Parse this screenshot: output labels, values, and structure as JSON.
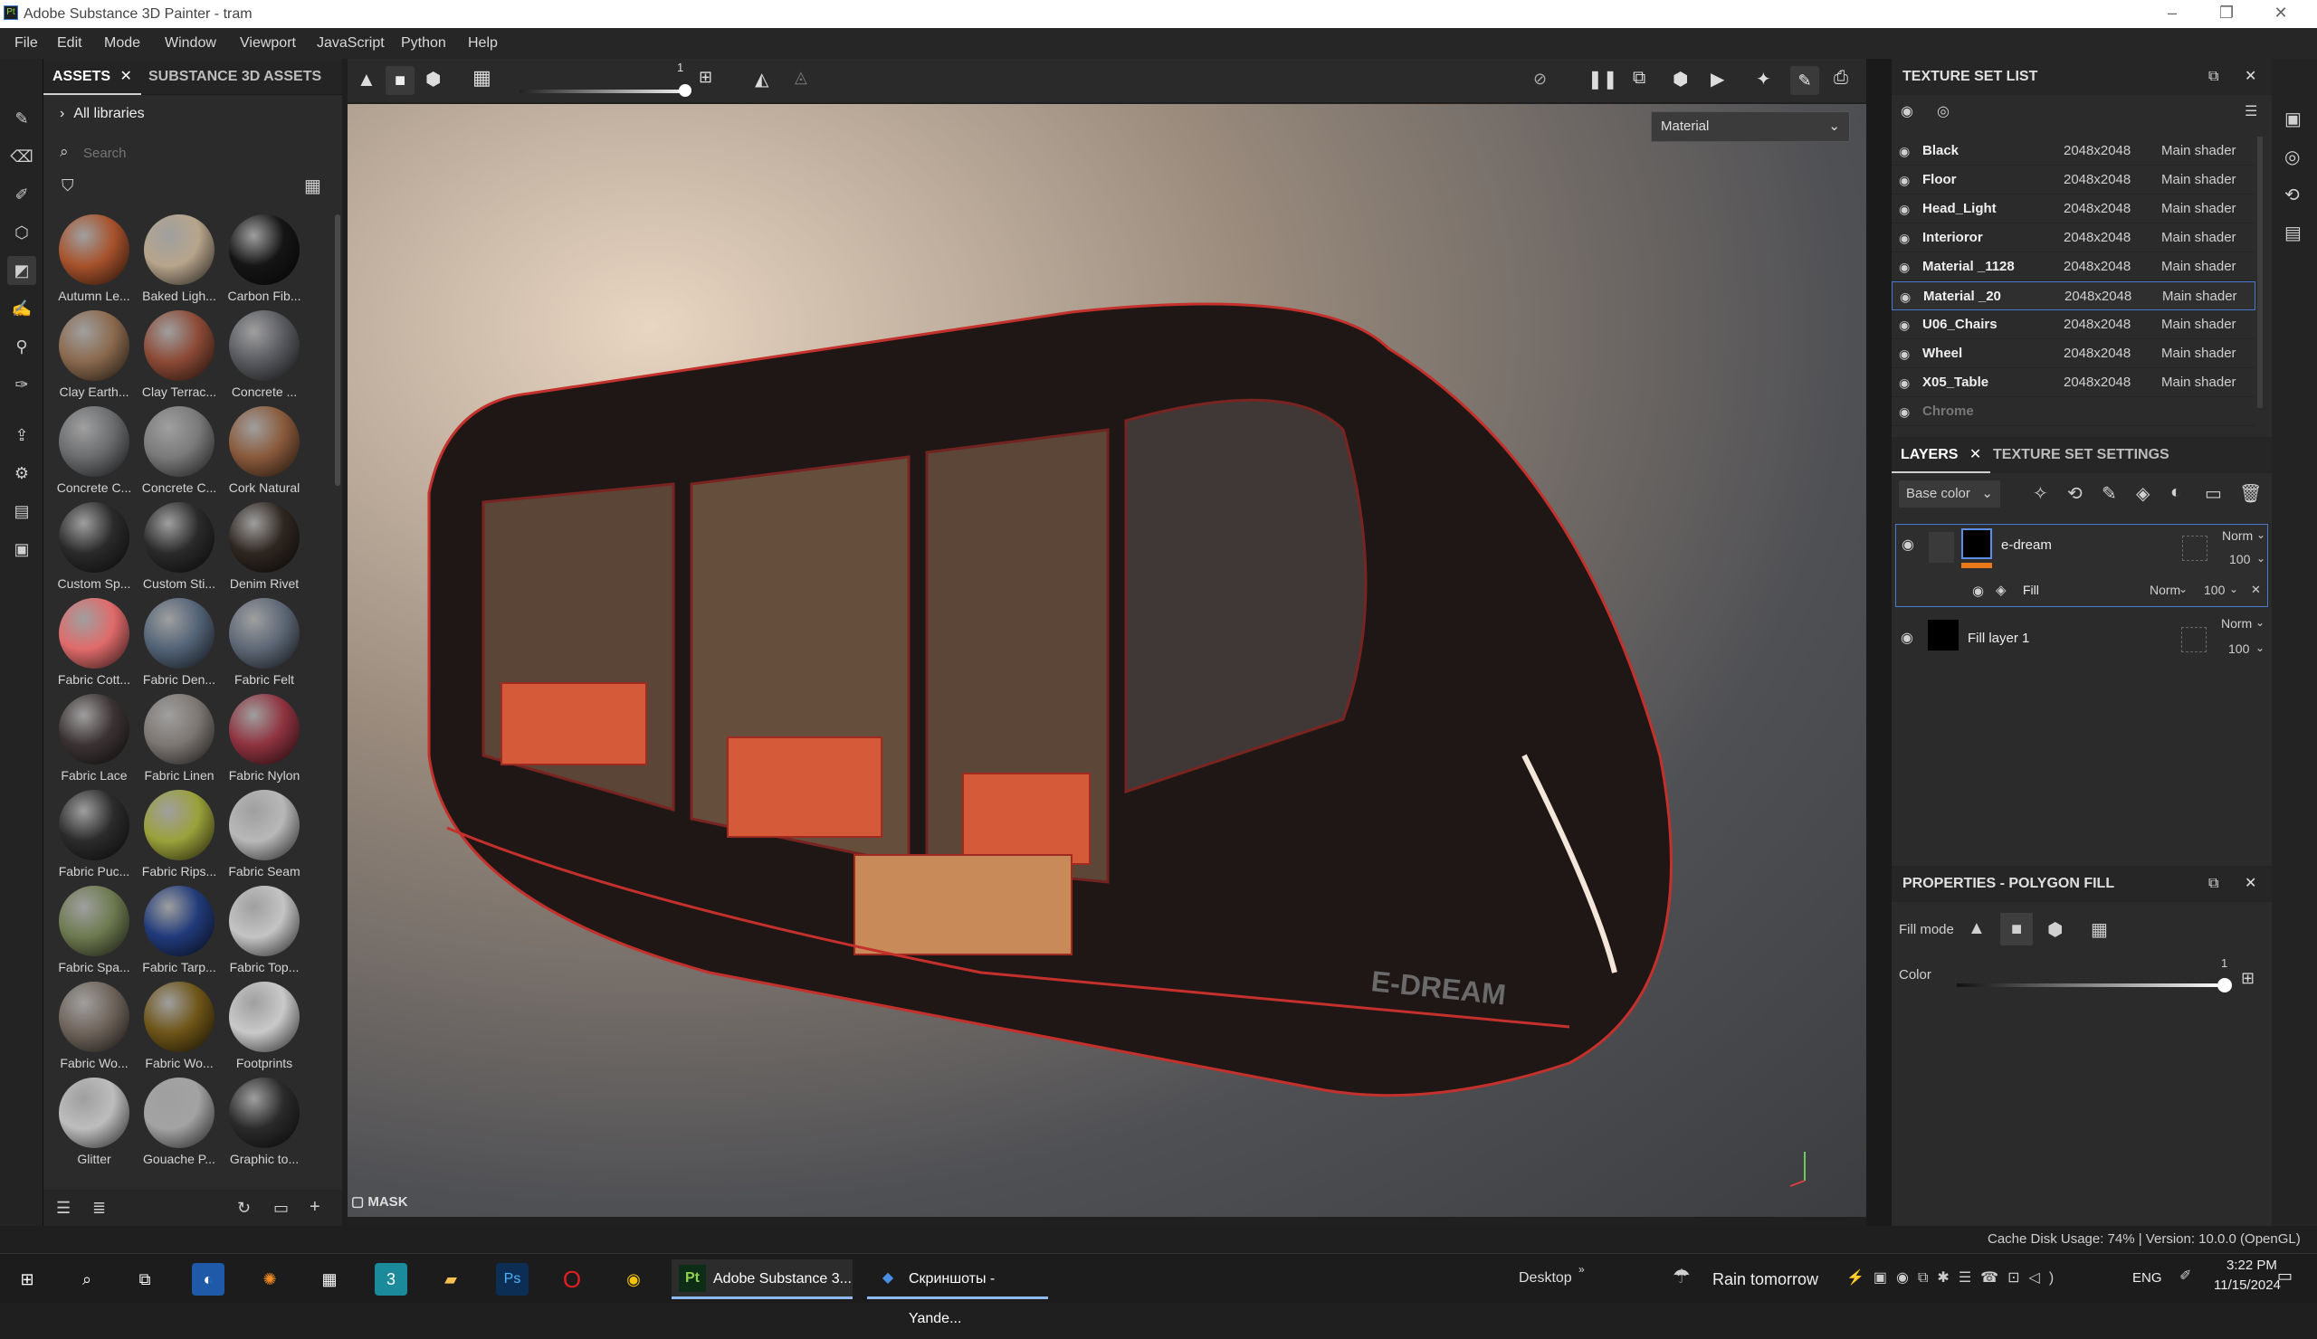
{
  "window": {
    "title": "Adobe Substance 3D Painter - tram",
    "app_icon": "Pt"
  },
  "menu": [
    "File",
    "Edit",
    "Mode",
    "Window",
    "Viewport",
    "JavaScript",
    "Python",
    "Help"
  ],
  "assets": {
    "tabs": [
      "ASSETS",
      "SUBSTANCE 3D ASSETS"
    ],
    "library": "All libraries",
    "search_placeholder": "Search",
    "items": [
      {
        "label": "Autumn Le...",
        "color": "#a7522c"
      },
      {
        "label": "Baked Ligh...",
        "color": "#b7a58c"
      },
      {
        "label": "Carbon Fib...",
        "color": "#151515"
      },
      {
        "label": "Clay Earth...",
        "color": "#8b6a4e"
      },
      {
        "label": "Clay Terrac...",
        "color": "#8c4a36"
      },
      {
        "label": "Concrete ...",
        "color": "#5a5b60"
      },
      {
        "label": "Concrete C...",
        "color": "#6b6c6e"
      },
      {
        "label": "Concrete C...",
        "color": "#7a7a7a"
      },
      {
        "label": "Cork Natural",
        "color": "#8a5a3c"
      },
      {
        "label": "Custom Sp...",
        "color": "#2a2a2a"
      },
      {
        "label": "Custom Sti...",
        "color": "#2a2a2a"
      },
      {
        "label": "Denim Rivet",
        "color": "#2e2620"
      },
      {
        "label": "Fabric Cott...",
        "color": "#e06b6b"
      },
      {
        "label": "Fabric Den...",
        "color": "#536377"
      },
      {
        "label": "Fabric Felt",
        "color": "#5e6876"
      },
      {
        "label": "Fabric Lace",
        "color": "#3b3333"
      },
      {
        "label": "Fabric Linen",
        "color": "#7d7773"
      },
      {
        "label": "Fabric Nylon",
        "color": "#8f3340"
      },
      {
        "label": "Fabric Puc...",
        "color": "#2b2b2b"
      },
      {
        "label": "Fabric Rips...",
        "color": "#9aa13a"
      },
      {
        "label": "Fabric Seam",
        "color": "#b8b8b8"
      },
      {
        "label": "Fabric Spa...",
        "color": "#6e7a50"
      },
      {
        "label": "Fabric Tarp...",
        "color": "#213a7a"
      },
      {
        "label": "Fabric Top...",
        "color": "#c4c4c4"
      },
      {
        "label": "Fabric Wo...",
        "color": "#6f645b"
      },
      {
        "label": "Fabric Wo...",
        "color": "#6e5518"
      },
      {
        "label": "Footprints",
        "color": "#c9c9c9"
      },
      {
        "label": "Glitter",
        "color": "#bdbdbd"
      },
      {
        "label": "Gouache P...",
        "color": "#a3a3a3"
      },
      {
        "label": "Graphic to...",
        "color": "#2a2a2a"
      }
    ]
  },
  "viewport": {
    "slider_value": "1",
    "material_dropdown": "Material",
    "mask_label": "MASK",
    "model_logo": "E-DREAM"
  },
  "texture_set_list": {
    "title": "TEXTURE SET LIST",
    "rows": [
      {
        "name": "Black",
        "size": "2048x2048",
        "shader": "Main shader"
      },
      {
        "name": "Floor",
        "size": "2048x2048",
        "shader": "Main shader"
      },
      {
        "name": "Head_Light",
        "size": "2048x2048",
        "shader": "Main shader"
      },
      {
        "name": "Interioror",
        "size": "2048x2048",
        "shader": "Main shader"
      },
      {
        "name": "Material _1128",
        "size": "2048x2048",
        "shader": "Main shader"
      },
      {
        "name": "Material _20",
        "size": "2048x2048",
        "shader": "Main shader"
      },
      {
        "name": "U06_Chairs",
        "size": "2048x2048",
        "shader": "Main shader"
      },
      {
        "name": "Wheel",
        "size": "2048x2048",
        "shader": "Main shader"
      },
      {
        "name": "X05_Table",
        "size": "2048x2048",
        "shader": "Main shader"
      },
      {
        "name": "Chrome",
        "size": "",
        "shader": ""
      }
    ]
  },
  "layers": {
    "tabs": [
      "LAYERS",
      "TEXTURE SET SETTINGS"
    ],
    "channel": "Base color",
    "items": [
      {
        "name": "e-dream",
        "blend": "Norm",
        "opacity": "100"
      },
      {
        "name": "Fill",
        "blend": "Norm",
        "opacity": "100"
      },
      {
        "name": "Fill layer 1",
        "blend": "Norm",
        "opacity": "100"
      }
    ]
  },
  "properties": {
    "title": "PROPERTIES - POLYGON FILL",
    "fill_mode_label": "Fill mode",
    "color_label": "Color",
    "color_value": "1"
  },
  "status": {
    "text": "Cache Disk Usage:  74% | Version: 10.0.0 (OpenGL)"
  },
  "taskbar": {
    "apps": [
      "Adobe Substance 3...",
      "Скриншоты - Yande..."
    ],
    "desktop": "Desktop",
    "weather": "Rain tomorrow",
    "lang": "ENG",
    "time": "3:22 PM",
    "date": "11/15/2024"
  }
}
